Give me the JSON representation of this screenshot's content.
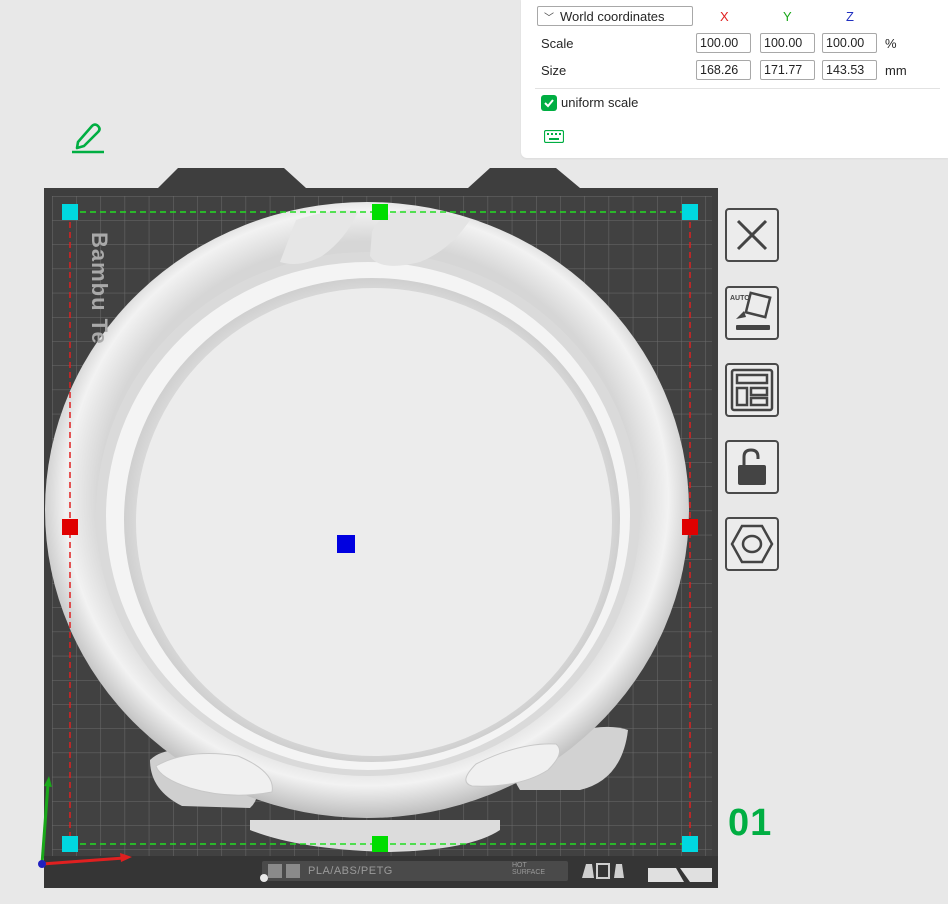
{
  "scale_panel": {
    "coordinate_system": "World coordinates",
    "axes": {
      "x": "X",
      "y": "Y",
      "z": "Z"
    },
    "axis_colors": {
      "x": "#e02020",
      "y": "#1aa81a",
      "z": "#2030c0"
    },
    "scale": {
      "label": "Scale",
      "x": "100.00",
      "y": "100.00",
      "z": "100.00",
      "unit": "%"
    },
    "size": {
      "label": "Size",
      "x": "168.26",
      "y": "171.77",
      "z": "143.53",
      "unit": "mm"
    },
    "uniform_scale": {
      "label": "uniform scale",
      "checked": true
    }
  },
  "viewport": {
    "plate_number": "01",
    "bed_brand": "Bambu Te",
    "filament_types": "PLA/ABS/PETG",
    "surface_label": "HOT SURFACE",
    "accent_color": "#00ae42"
  },
  "toolbar": {
    "buttons": [
      {
        "name": "close",
        "icon": "close-icon"
      },
      {
        "name": "auto-orient",
        "icon": "auto-orient-icon",
        "badge": "AUTO"
      },
      {
        "name": "arrange",
        "icon": "arrange-icon"
      },
      {
        "name": "lock",
        "icon": "unlock-icon"
      },
      {
        "name": "hex",
        "icon": "hex-nut-icon"
      }
    ]
  },
  "icons": {
    "edit": "edit-pencil-icon",
    "keyboard": "keyboard-icon"
  }
}
